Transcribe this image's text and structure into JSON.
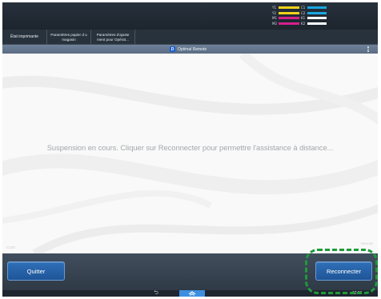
{
  "toner": [
    {
      "label_left": "Y1",
      "color_left": "#f1d21a",
      "label_right": "C1",
      "color_right": "#1aa6e0"
    },
    {
      "label_left": "Y2",
      "color_left": "#f1d21a",
      "label_right": "C2",
      "color_right": "#1aa6e0"
    },
    {
      "label_left": "M1",
      "color_left": "#d6208a",
      "label_right": "K1",
      "color_right": "#ffffff"
    },
    {
      "label_left": "M2",
      "color_left": "#d6208a",
      "label_right": "K2",
      "color_right": "#ffffff"
    }
  ],
  "tabs": [
    {
      "label": "État imprimante"
    },
    {
      "label": "Paramètres papier d u magasin"
    },
    {
      "label": "Paramètres d'ajuste ment pour Opérat..."
    }
  ],
  "app_bar": {
    "logo": "D",
    "title": "Optimal Remote",
    "menu_icon": "kebab-menu-icon"
  },
  "content": {
    "message": "Suspension en cours. Cliquer sur Reconnecter pour permettre l'assistance à distance...",
    "code_left": "C100",
    "code_right": "RBW0186"
  },
  "actions": {
    "quit_label": "Quitter",
    "reconnect_label": "Reconnecter"
  },
  "nav": {
    "back_icon": "back-arrow-icon",
    "home_icon": "home-icon",
    "time": "12:51"
  },
  "colors": {
    "accent": "#1e5597",
    "highlight": "#1f9a3a",
    "home_tab": "#3c8fe0"
  }
}
